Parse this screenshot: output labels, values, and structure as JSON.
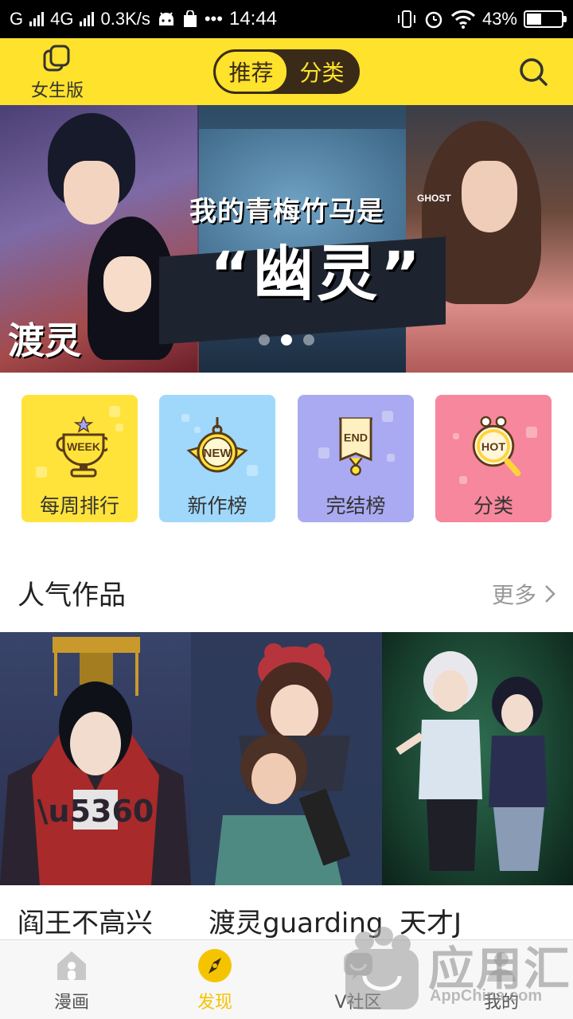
{
  "status_bar": {
    "carrier": "G",
    "network": "4G",
    "speed": "0.3K/s",
    "dots": "•••",
    "time": "14:44",
    "battery_pct": "43%",
    "battery_level": 0.43
  },
  "top_bar": {
    "girl_label": "女生版",
    "tabs": [
      {
        "label": "推荐",
        "active": true
      },
      {
        "label": "分类",
        "active": false
      }
    ],
    "search_icon": "search-icon"
  },
  "banner": {
    "line1": "我的青梅竹马是",
    "ghost": "GHOST",
    "line2": "“幽灵”",
    "logo": "渡灵",
    "page_count": 3,
    "active_page": 2
  },
  "categories": [
    {
      "name": "每周排行",
      "badge": "WEEK",
      "icon": "trophy-icon",
      "bg": "#ffe33a"
    },
    {
      "name": "新作榜",
      "badge": "NEW",
      "icon": "medal-icon",
      "bg": "#9fd8fb"
    },
    {
      "name": "完结榜",
      "badge": "END",
      "icon": "ribbon-icon",
      "bg": "#aaaaf2"
    },
    {
      "name": "分类",
      "badge": "HOT",
      "icon": "magnifier-hot-icon",
      "bg": "#f7879c"
    }
  ],
  "popular": {
    "title": "人气作品",
    "more": "更多",
    "works": [
      {
        "title": "阎王不高兴"
      },
      {
        "title": "渡灵guarding"
      },
      {
        "title": "天才J"
      }
    ]
  },
  "bottom_nav": [
    {
      "label": "漫画",
      "icon": "home-icon",
      "active": false
    },
    {
      "label": "发现",
      "icon": "discover-icon",
      "active": true
    },
    {
      "label": "V社区",
      "icon": "community-icon",
      "active": false
    },
    {
      "label": "我的",
      "icon": "profile-icon",
      "active": false
    }
  ],
  "watermark": {
    "main": "应用汇",
    "sub": "AppChina.com"
  },
  "colors": {
    "brand_yellow": "#ffe22b",
    "segment_dark": "#3a2b19",
    "active_nav": "#f5c400"
  }
}
